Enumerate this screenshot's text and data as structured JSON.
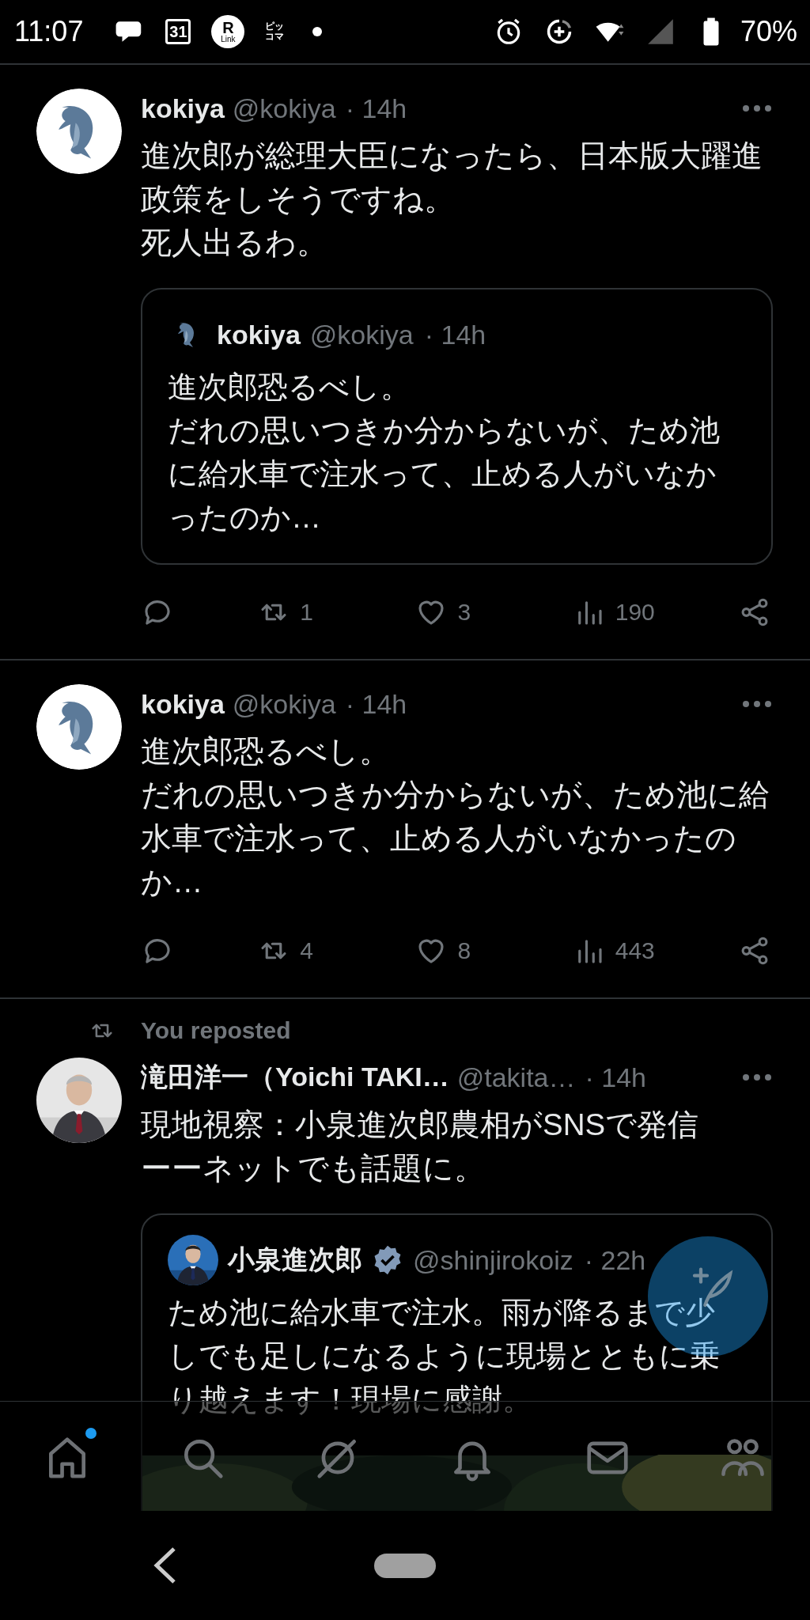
{
  "status_bar": {
    "time": "11:07",
    "notifications": [
      {
        "kind": "messages"
      },
      {
        "kind": "calendar",
        "label": "31"
      },
      {
        "kind": "round_app",
        "labels": [
          "R",
          "Link"
        ]
      },
      {
        "kind": "square_app",
        "labels": [
          "ピッ",
          "コマ"
        ]
      },
      {
        "kind": "dot"
      }
    ],
    "system_icons": [
      {
        "kind": "alarm"
      },
      {
        "kind": "data_saver"
      },
      {
        "kind": "wifi"
      },
      {
        "kind": "signal"
      },
      {
        "kind": "battery"
      }
    ],
    "battery": "70%"
  },
  "feed": [
    {
      "author": {
        "name": "kokiya",
        "handle": "@kokiya",
        "time": "· 14h",
        "avatar": {
          "kind": "dolphin"
        }
      },
      "lines": [
        "進次郎が総理大臣になったら、日本版大躍進政策をしそうですね。",
        "死人出るわ。"
      ],
      "quote": {
        "author": {
          "name": "kokiya",
          "handle": "@kokiya",
          "time": "· 14h",
          "avatar": {
            "kind": "dolphin"
          },
          "verified": false
        },
        "lines": [
          "進次郎恐るべし。",
          "だれの思いつきか分からないが、ため池に給水車で注水って、止める人がいなかったのか…"
        ]
      },
      "actions": [
        {
          "kind": "reply"
        },
        {
          "kind": "repost",
          "count": "1"
        },
        {
          "kind": "like",
          "count": "3"
        },
        {
          "kind": "views",
          "count": "190"
        },
        {
          "kind": "share"
        }
      ]
    },
    {
      "author": {
        "name": "kokiya",
        "handle": "@kokiya",
        "time": "· 14h",
        "avatar": {
          "kind": "dolphin"
        }
      },
      "lines": [
        "進次郎恐るべし。",
        "だれの思いつきか分からないが、ため池に給水車で注水って、止める人がいなかったのか…"
      ],
      "actions": [
        {
          "kind": "reply"
        },
        {
          "kind": "repost",
          "count": "4"
        },
        {
          "kind": "like",
          "count": "8"
        },
        {
          "kind": "views",
          "count": "443"
        },
        {
          "kind": "share"
        }
      ]
    },
    {
      "repost_label": "You reposted",
      "author": {
        "name": "滝田洋一（Yoichi TAKI…",
        "handle": "@takita…",
        "time": "· 14h",
        "avatar": {
          "kind": "picture"
        }
      },
      "lines": [
        "現地視察：小泉進次郎農相がSNSで発信",
        "ーーネットでも話題に。"
      ],
      "quote": {
        "author": {
          "name": "小泉進次郎",
          "handle": "@shinjirokoiz",
          "time": "· 22h",
          "avatar": {
            "kind": "picture"
          },
          "verified": true
        },
        "lines": [
          "ため池に給水車で注水。雨が降るまで少しでも足しになるように現場とともに乗り越えます！現場に感謝。"
        ],
        "media": {
          "kind": "picture"
        }
      }
    }
  ],
  "nav_bar": {
    "items": [
      {
        "kind": "home",
        "unread": true
      },
      {
        "kind": "search",
        "unread": false
      },
      {
        "kind": "grok",
        "unread": false
      },
      {
        "kind": "notifications",
        "unread": false
      },
      {
        "kind": "messages",
        "unread": false
      },
      {
        "kind": "communities",
        "unread": false
      }
    ]
  }
}
